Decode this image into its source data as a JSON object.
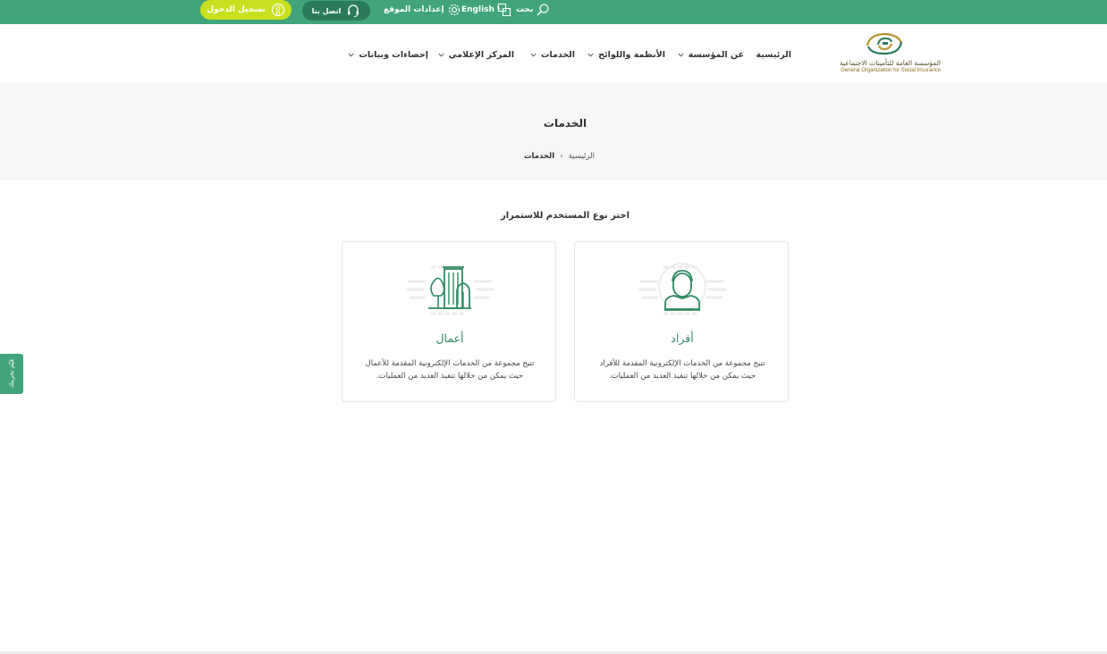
{
  "topbar": {
    "search_label": "بحث",
    "language_label": "English",
    "settings_label": "إعدادات الموقع",
    "contact_label": "اتصل بنا",
    "login_label": "تسجيل الدخول"
  },
  "logo": {
    "arabic_name": "المؤسسة العامة للتأمينات الاجتماعية",
    "english_name": "General Organization for Social Insurance"
  },
  "nav": {
    "home": "الرئيسية",
    "about": "عن المؤسسة",
    "regulations": "الأنظمة واللوائح",
    "services": "الخدمات",
    "media": "المركز الإعلامي",
    "statistics": "إحصاءات وبيانات"
  },
  "banner": {
    "title": "الخدمات",
    "breadcrumb_home": "الرئيسية",
    "breadcrumb_current": "الخدمات"
  },
  "content": {
    "prompt": "اختر نوع المستخدم للاستمرار",
    "cards": [
      {
        "title": "أفراد",
        "line1": "تتيح مجموعة من الخدمات الإلكترونية المقدمة للأفراد",
        "line2": "حيث يمكن من خلالها تنفيذ العديد من العمليات."
      },
      {
        "title": "أعمال",
        "line1": "تتيح مجموعة من الخدمات الإلكترونية المقدمة للأعمال",
        "line2": "حيث يمكن من خلالها تنفيذ العديد من العمليات."
      }
    ]
  },
  "side_tab": {
    "label": "قيّم تجربتك"
  },
  "colors": {
    "primary_green": "#41a47a",
    "dark_green": "#2b7b5a",
    "login_yellow": "#c9e01e",
    "card_green": "#2e8b62"
  },
  "icons": [
    "search-icon",
    "translate-icon",
    "gear-icon",
    "headset-icon",
    "user-circle-icon",
    "chevron-down-icon",
    "chevron-left-icon",
    "person-icon",
    "building-icon"
  ]
}
